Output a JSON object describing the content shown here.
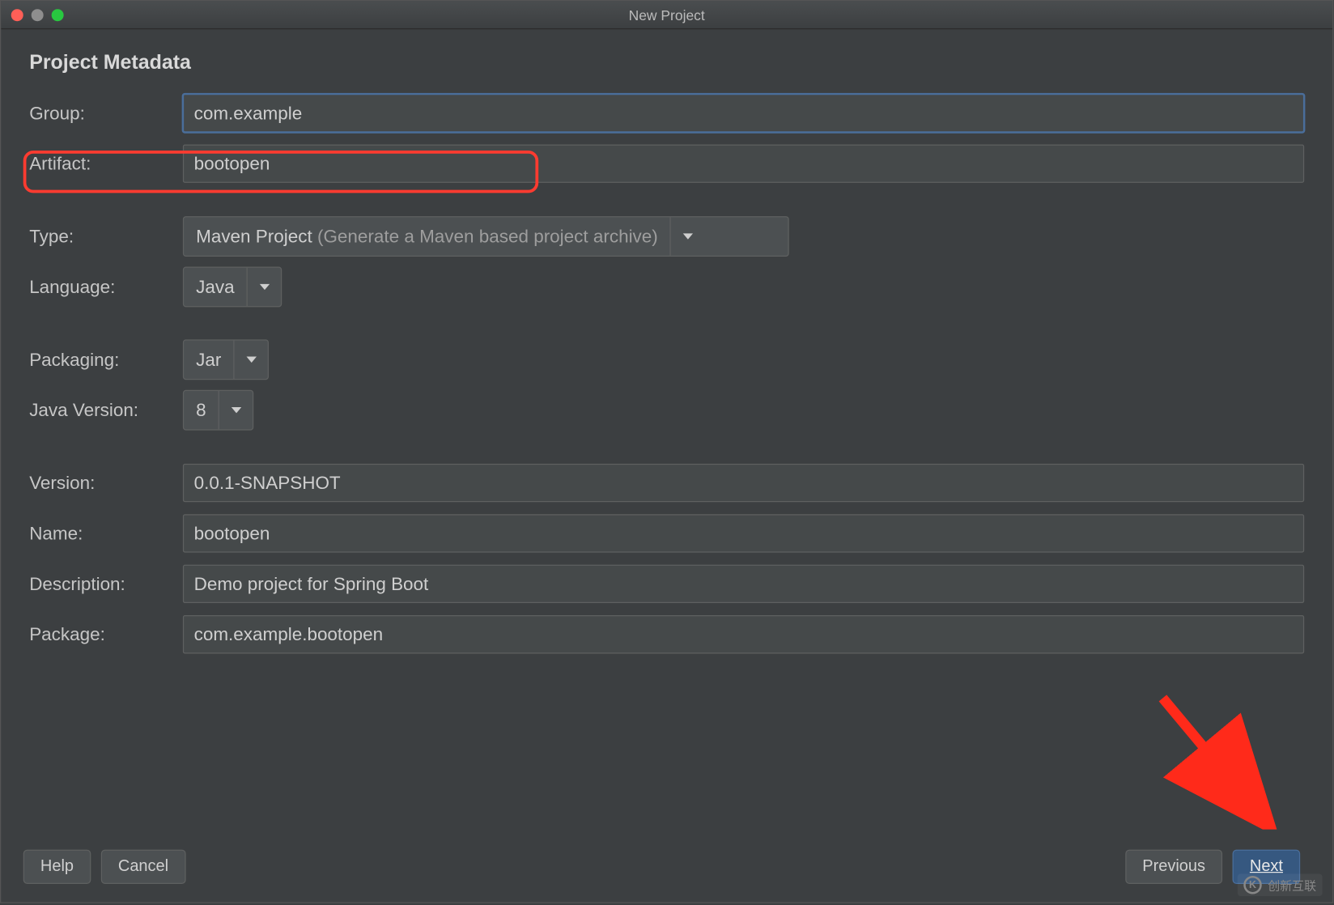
{
  "window": {
    "title": "New Project"
  },
  "section": {
    "title": "Project Metadata"
  },
  "fields": {
    "group": {
      "label": "Group:",
      "value": "com.example"
    },
    "artifact": {
      "label": "Artifact:",
      "value": "bootopen"
    },
    "type": {
      "label": "Type:",
      "selected": "Maven Project",
      "hint": "(Generate a Maven based project archive)"
    },
    "language": {
      "label": "Language:",
      "selected": "Java"
    },
    "packaging": {
      "label": "Packaging:",
      "selected": "Jar"
    },
    "java_version": {
      "label": "Java Version:",
      "selected": "8"
    },
    "version": {
      "label": "Version:",
      "value": "0.0.1-SNAPSHOT"
    },
    "name": {
      "label": "Name:",
      "value": "bootopen"
    },
    "description": {
      "label": "Description:",
      "value": "Demo project for Spring Boot"
    },
    "package": {
      "label": "Package:",
      "value": "com.example.bootopen"
    }
  },
  "buttons": {
    "help": "Help",
    "cancel": "Cancel",
    "previous": "Previous",
    "next": "Next"
  },
  "watermark": {
    "text": "创新互联"
  }
}
